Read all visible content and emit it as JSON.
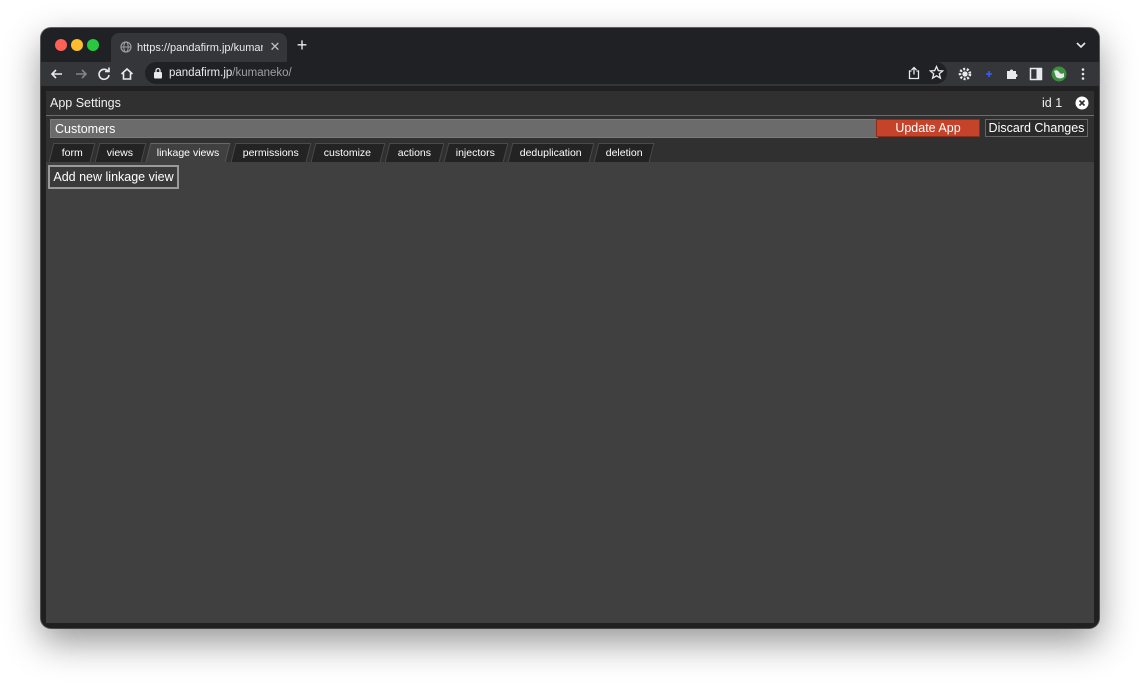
{
  "browser": {
    "tab_title": "https://pandafirm.jp/kumaneko/",
    "tab_close_glyph": "✕",
    "new_tab_glyph": "+",
    "url_host": "pandafirm.jp",
    "url_path": "/kumaneko/"
  },
  "dialog": {
    "title": "App Settings",
    "id_label": "id 1",
    "app_name_value": "Customers",
    "update_label": "Update App",
    "discard_label": "Discard Changes",
    "add_linkage_view_label": "Add new linkage view"
  },
  "tabs": [
    {
      "label": "form"
    },
    {
      "label": "views"
    },
    {
      "label": "linkage views"
    },
    {
      "label": "permissions"
    },
    {
      "label": "customize"
    },
    {
      "label": "actions"
    },
    {
      "label": "injectors"
    },
    {
      "label": "deduplication"
    },
    {
      "label": "deletion"
    }
  ],
  "active_tab": "linkage views",
  "colors": {
    "accent": "#c5432a",
    "browser_frame": "#202124",
    "toolbar": "#35363a",
    "content_bg": "#404040"
  }
}
